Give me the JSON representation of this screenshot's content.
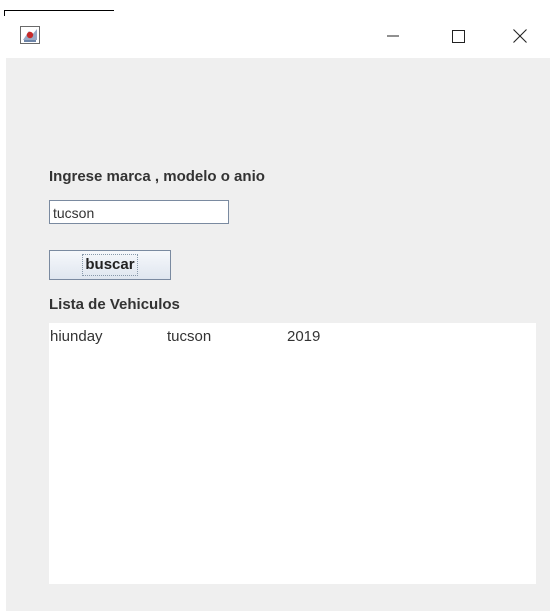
{
  "window": {
    "icon": "java-app-icon",
    "controls": {
      "minimize": "minimize-icon",
      "maximize": "maximize-icon",
      "close": "close-icon"
    }
  },
  "search": {
    "label": "Ingrese marca , modelo o anio",
    "value": "tucson",
    "button_label": "buscar"
  },
  "list": {
    "label": "Lista de Vehiculos",
    "rows": [
      {
        "brand": "hiunday",
        "model": "tucson",
        "year": "2019"
      }
    ]
  },
  "colors": {
    "window_bg": "#efefef",
    "titlebar_bg": "#ffffff",
    "list_bg": "#ffffff",
    "text": "#333333"
  }
}
